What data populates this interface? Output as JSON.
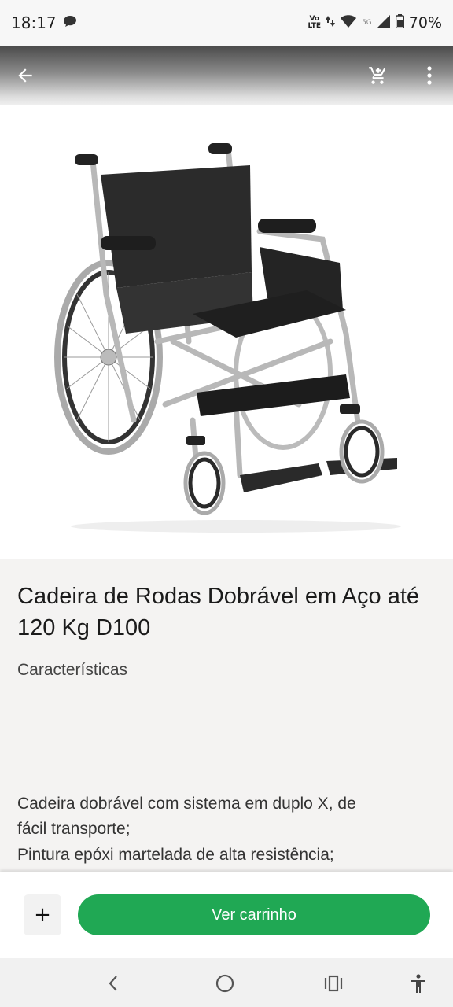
{
  "status_bar": {
    "time": "18:17",
    "network_top": "Vo",
    "network_bottom": "LTE",
    "signal_label": "5G",
    "battery": "70%"
  },
  "app_bar": {
    "icons": [
      "back-arrow-icon",
      "cart-icon",
      "more-vert-icon"
    ]
  },
  "product": {
    "image": "wheelchair-photo",
    "title": "Cadeira de Rodas Dobrável em Aço até 120 Kg D100",
    "section_label": "Características",
    "description_lines": [
      "Cadeira dobrável com sistema em duplo X, de",
      "fácil transporte;",
      "Pintura epóxi martelada de alta resistência;"
    ]
  },
  "action_bar": {
    "plus_label": "+",
    "cart_button_label": "Ver carrinho",
    "accent_color": "#20a854"
  }
}
